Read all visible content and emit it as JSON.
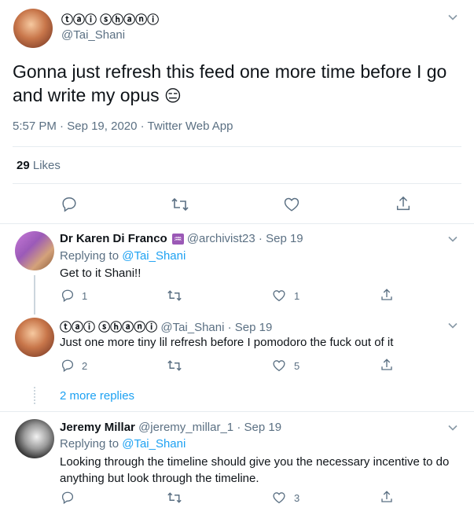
{
  "main_tweet": {
    "display_name": "ⓣⓐⓘ ⓢⓗⓐⓝⓘ",
    "handle": "@Tai_Shani",
    "text": "Gonna just refresh this feed one more time before I go and write my opus",
    "emoji": "😑",
    "time": "5:57 PM",
    "date": "Sep 19, 2020",
    "source": "Twitter Web App",
    "likes_count": "29",
    "likes_label": "Likes"
  },
  "replies": [
    {
      "display_name": "Dr Karen Di Franco",
      "badge": "♒",
      "handle": "@archivist23",
      "date": "Sep 19",
      "replying_prefix": "Replying to",
      "replying_to": "@Tai_Shani",
      "text": "Get to it Shani!!",
      "reply_count": "1",
      "like_count": "1"
    },
    {
      "display_name": "ⓣⓐⓘ ⓢⓗⓐⓝⓘ",
      "handle": "@Tai_Shani",
      "date": "Sep 19",
      "text": "Just one more tiny lil refresh before I pomodoro the fuck out of it",
      "reply_count": "2",
      "like_count": "5"
    },
    {
      "display_name": "Jeremy Millar",
      "handle": "@jeremy_millar_1",
      "date": "Sep 19",
      "replying_prefix": "Replying to",
      "replying_to": "@Tai_Shani",
      "text": "Looking through the timeline should give you the necessary incentive to do anything but look through the timeline.",
      "reply_count": "",
      "like_count": "3"
    }
  ],
  "more_replies": "2 more replies",
  "separator": "·",
  "colors": {
    "link": "#1da1f2",
    "muted": "#5b7083",
    "border": "#e6ecf0"
  }
}
